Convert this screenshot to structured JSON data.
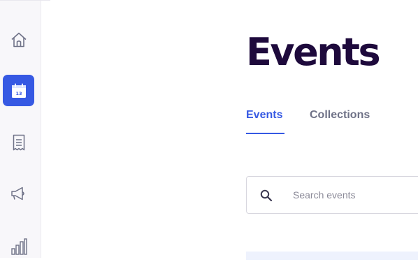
{
  "sidebar": {
    "items": [
      {
        "id": "home",
        "icon": "home-icon",
        "active": false
      },
      {
        "id": "events",
        "icon": "calendar-icon",
        "active": true,
        "calendar_day": "13"
      },
      {
        "id": "orders",
        "icon": "receipt-icon",
        "active": false
      },
      {
        "id": "marketing",
        "icon": "megaphone-icon",
        "active": false
      },
      {
        "id": "reporting",
        "icon": "bar-chart-icon",
        "active": false
      }
    ]
  },
  "page": {
    "title": "Events"
  },
  "tabs": [
    {
      "label": "Events",
      "active": true
    },
    {
      "label": "Collections",
      "active": false
    }
  ],
  "search": {
    "placeholder": "Search events",
    "value": ""
  },
  "colors": {
    "accent": "#3659e3",
    "title": "#1e0a3c",
    "muted_text": "#6f7287",
    "sidebar_bg": "#f8f7fa"
  }
}
